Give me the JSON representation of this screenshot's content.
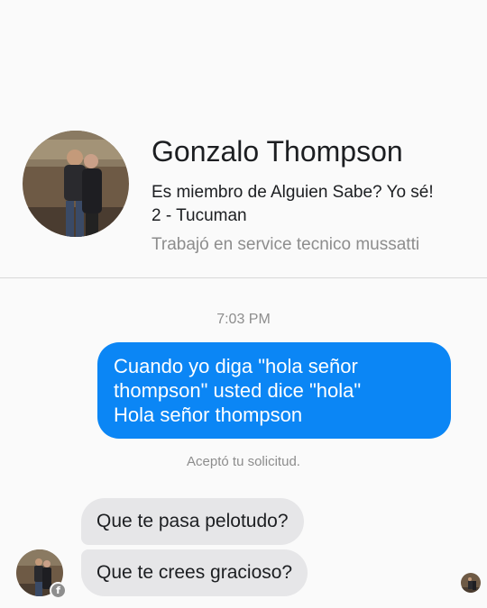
{
  "profile": {
    "name": "Gonzalo Thompson",
    "membership_line1": "Es miembro de Alguien Sabe? Yo sé!",
    "membership_line2": "2 - Tucuman",
    "work": "Trabajó en service tecnico mussatti"
  },
  "conversation": {
    "timestamp": "7:03 PM",
    "outgoing": {
      "lines": [
        "Cuando yo diga \"hola señor",
        "thompson\" usted dice \"hola\"",
        "Hola señor thompson"
      ]
    },
    "status_text": "Aceptó tu solicitud.",
    "incoming": [
      "Que te pasa pelotudo?",
      "Que te crees gracioso?"
    ]
  },
  "icons": {
    "profile_photo": "profile-photo-icon",
    "messenger_badge": "facebook-badge-icon",
    "read_receipt": "read-receipt-avatar-icon"
  },
  "colors": {
    "outgoing_bubble": "#0b86f5",
    "incoming_bubble": "#e6e6e8",
    "meta_text": "#8d8d8d"
  }
}
